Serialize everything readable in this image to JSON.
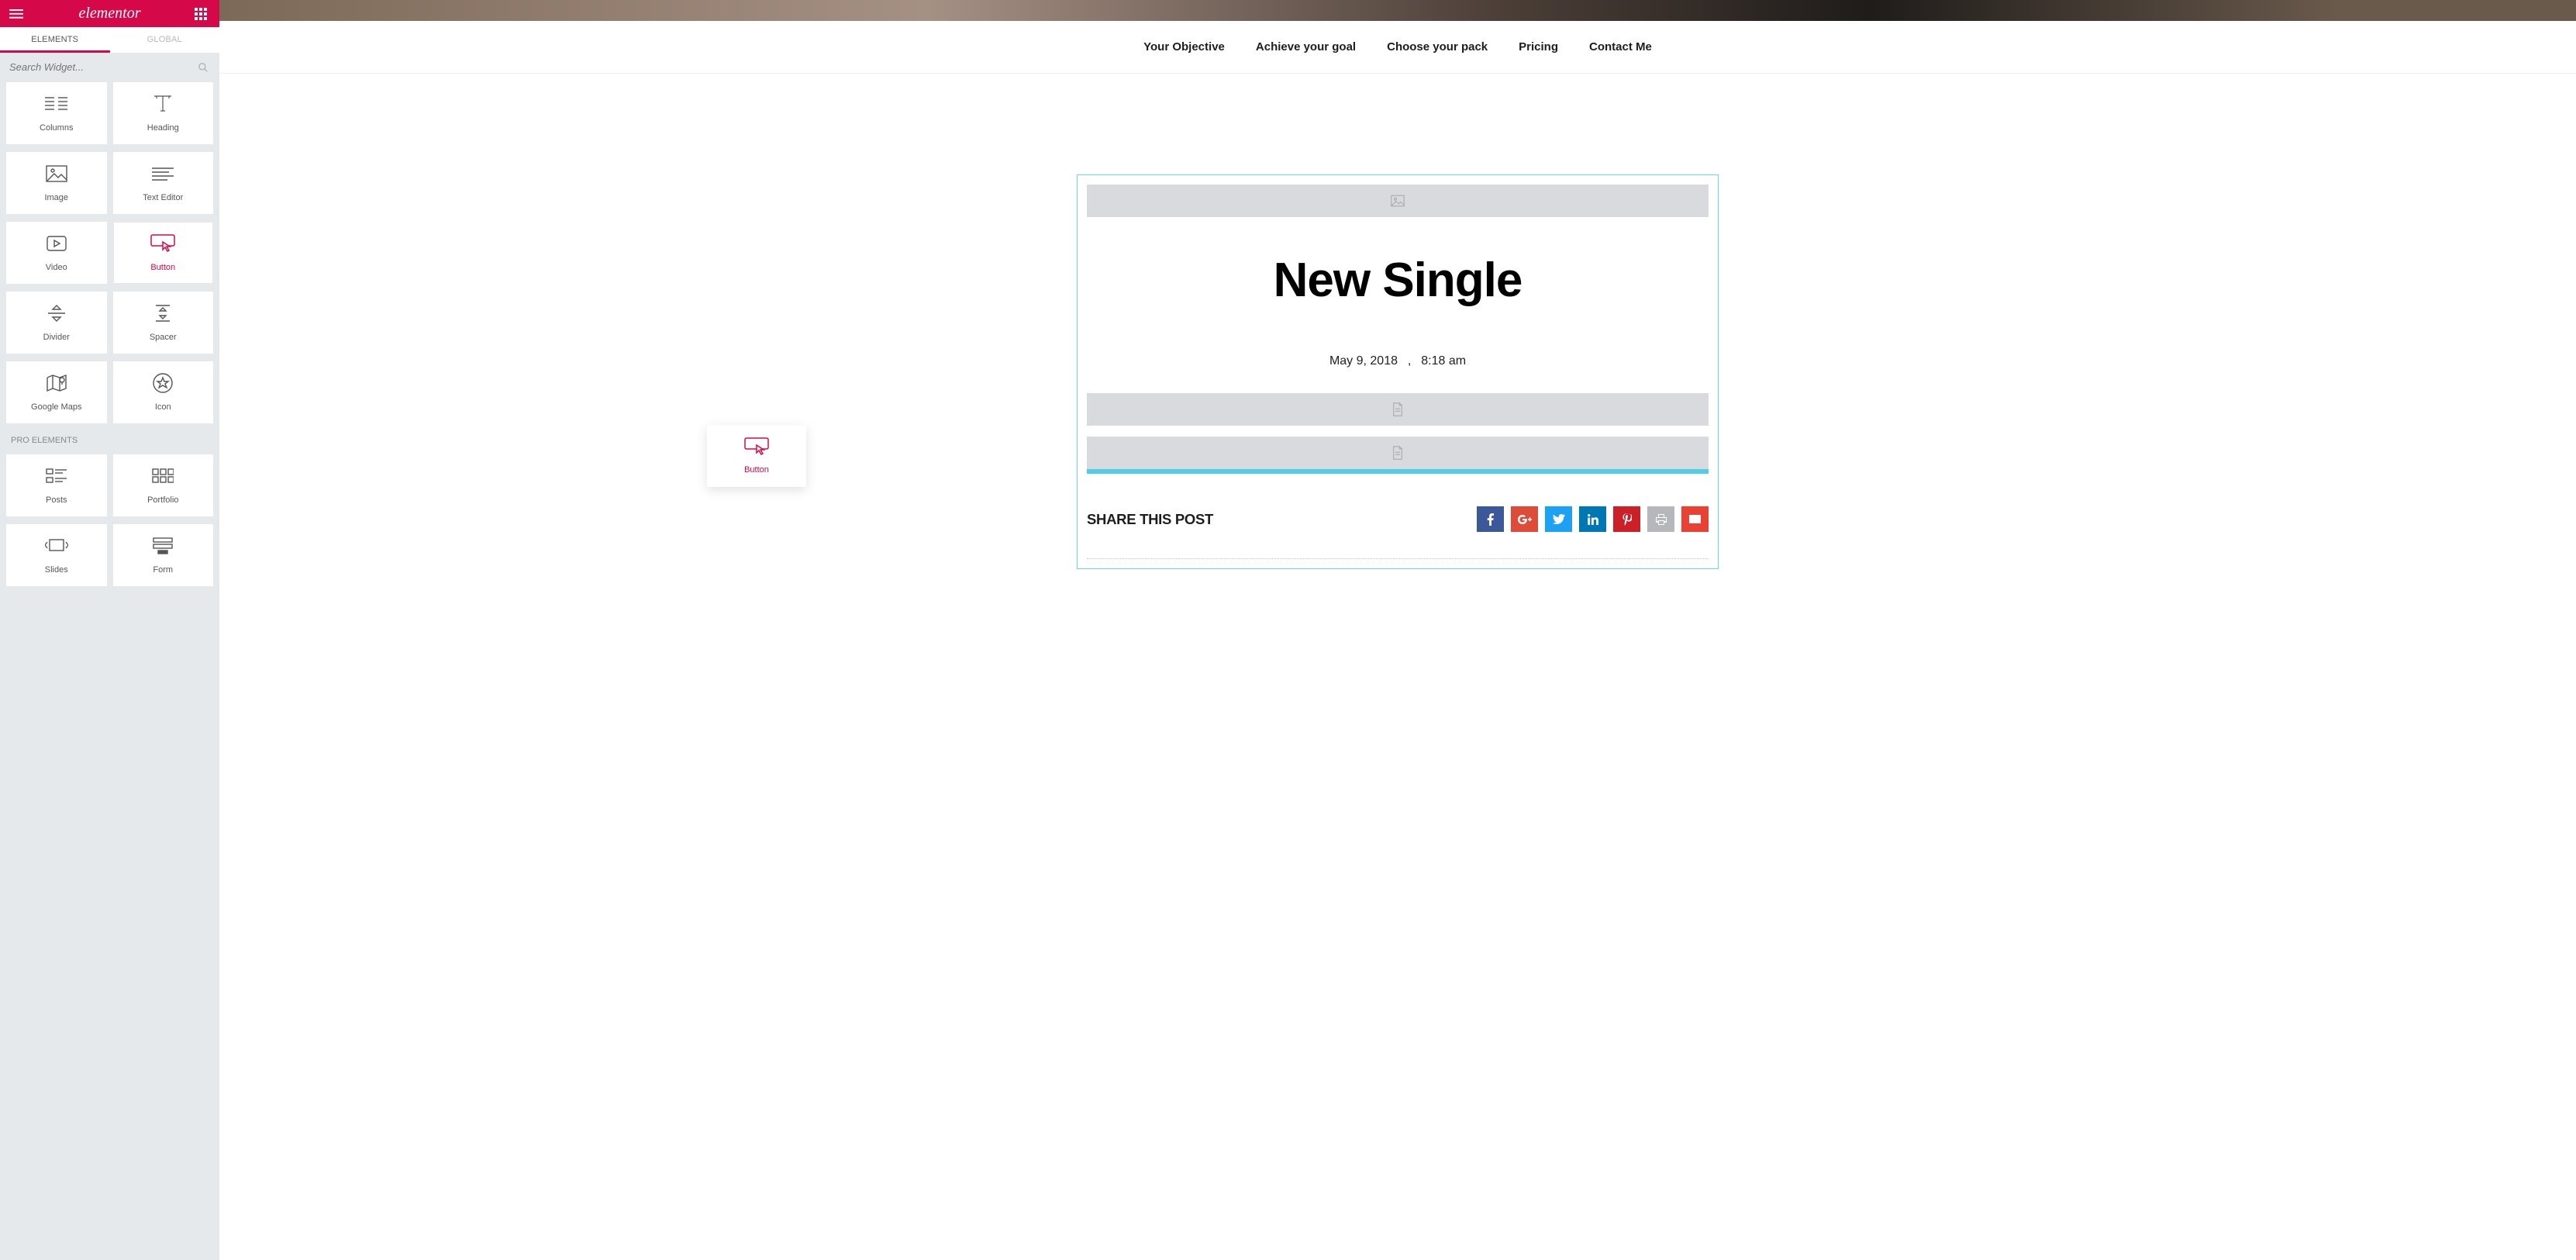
{
  "brand": "elementor",
  "tabs": {
    "elements": "ELEMENTS",
    "global": "GLOBAL"
  },
  "search": {
    "placeholder": "Search Widget..."
  },
  "widgets": {
    "columns": "Columns",
    "heading": "Heading",
    "image": "Image",
    "text_editor": "Text Editor",
    "video": "Video",
    "button": "Button",
    "divider": "Divider",
    "spacer": "Spacer",
    "google_maps": "Google Maps",
    "icon": "Icon"
  },
  "pro_section": "PRO ELEMENTS",
  "pro_widgets": {
    "posts": "Posts",
    "portfolio": "Portfolio",
    "slides": "Slides",
    "form": "Form"
  },
  "nav": [
    "Your Objective",
    "Achieve your goal",
    "Choose your pack",
    "Pricing",
    "Contact Me"
  ],
  "post": {
    "title": "New Single",
    "date": "May 9, 2018",
    "time": "8:18 am"
  },
  "share_heading": "SHARE THIS POST",
  "drag_ghost_label": "Button",
  "colors": {
    "brand": "#d5084a",
    "drop_highlight": "#50cfe4",
    "section_outline": "#67d6e8"
  }
}
